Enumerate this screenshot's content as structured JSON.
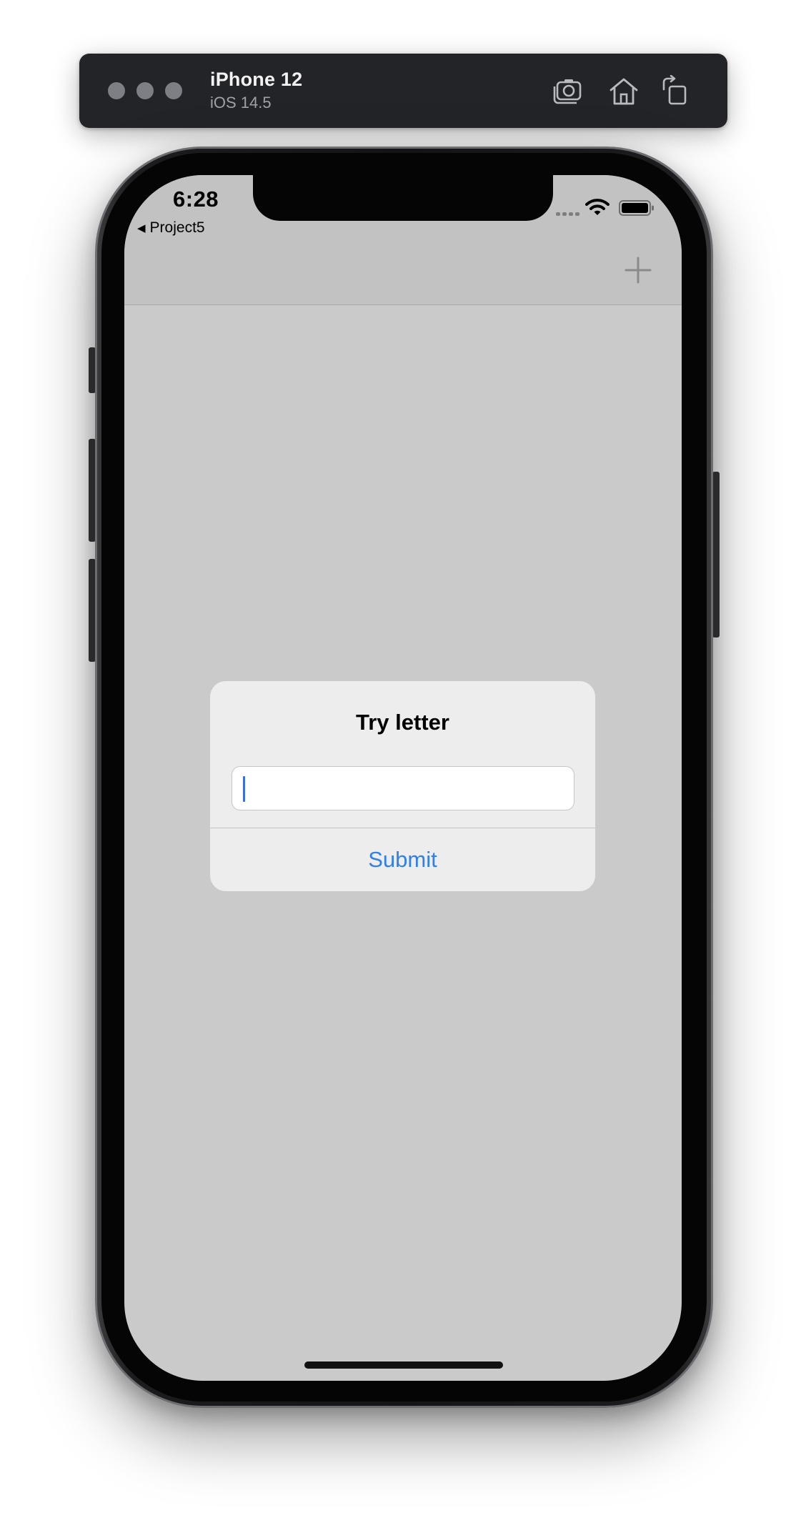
{
  "simulator": {
    "device_name": "iPhone 12",
    "os_version": "iOS 14.5",
    "toolbar_icons": [
      "screenshot-icon",
      "home-icon",
      "rotate-icon"
    ]
  },
  "status_bar": {
    "time": "6:28",
    "back_app": "Project5",
    "icons": [
      "signal-icon",
      "wifi-icon",
      "battery-icon"
    ]
  },
  "nav_bar": {
    "right_button_icon": "plus-icon"
  },
  "alert": {
    "title": "Try letter",
    "input_value": "",
    "action_label": "Submit"
  },
  "colors": {
    "tint": "#2f80ea",
    "caret": "#3a6fd8",
    "screen_dimmed": "#cacaca",
    "alert_bg": "#ededed",
    "toolbar_bg": "#232428"
  }
}
